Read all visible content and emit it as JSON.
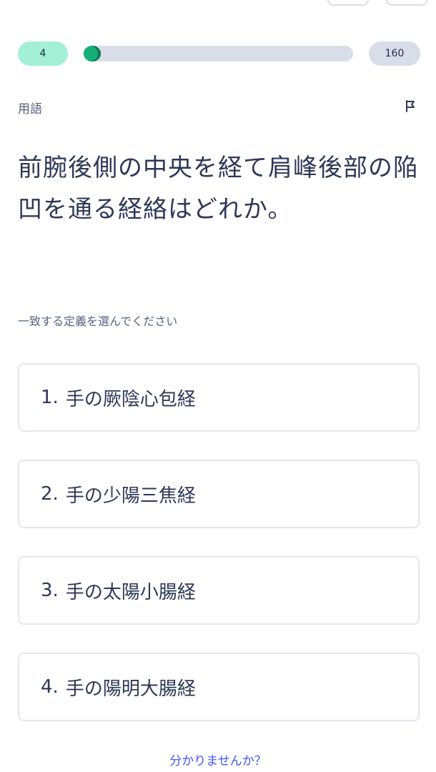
{
  "progress": {
    "current": "4",
    "total": "160",
    "fraction": 0.025
  },
  "term_label": "用語",
  "question": "前腕後側の中央を経て肩峰後部の陥凹を通る経絡はどれか。",
  "instruction": "一致する定義を選んでください",
  "choices": [
    {
      "num": "1.",
      "text": "手の厥陰心包経"
    },
    {
      "num": "2.",
      "text": "手の少陽三焦経"
    },
    {
      "num": "3.",
      "text": "手の太陽小腸経"
    },
    {
      "num": "4.",
      "text": "手の陽明大腸経"
    }
  ],
  "dont_know": "分かりませんか？",
  "icons": {
    "flag": "flag-icon"
  },
  "colors": {
    "accent_green": "#18ae79",
    "pill_green": "#a3f0d6",
    "track": "#d9dde8",
    "link": "#4255ff"
  }
}
